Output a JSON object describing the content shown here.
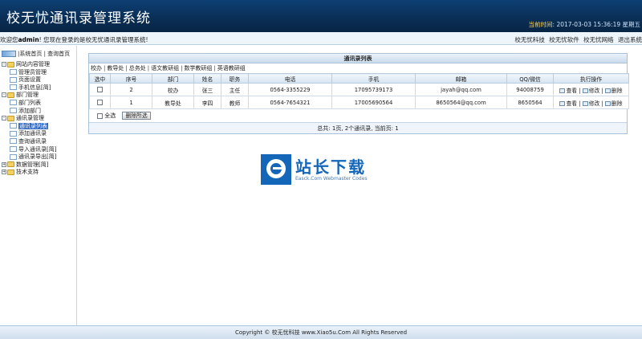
{
  "header": {
    "title": "校无忧通讯录管理系统",
    "time_label": "当前时间:",
    "time_value": "2017-03-03 15:36:19 星期五"
  },
  "topbar": {
    "welcome_prefix": "欢迎您",
    "user": "admin",
    "welcome_suffix": "! 您现在登录的是校无忧通讯录管理系统!",
    "links": [
      "校无忧科技",
      "校无忧软件",
      "校无忧网络",
      "退出系统"
    ]
  },
  "sidebar": {
    "quick_links": "|系统首页 | 查询首页",
    "tree": [
      {
        "label": "网站内容管理",
        "level": 0,
        "type": "folder",
        "pm": "-"
      },
      {
        "label": "管理员管理",
        "level": 1,
        "type": "page"
      },
      {
        "label": "页面设置",
        "level": 1,
        "type": "page"
      },
      {
        "label": "手机信息[简]",
        "level": 1,
        "type": "page"
      },
      {
        "label": "部门管理",
        "level": 0,
        "type": "folder",
        "pm": "-"
      },
      {
        "label": "部门列表",
        "level": 1,
        "type": "page"
      },
      {
        "label": "添加部门",
        "level": 1,
        "type": "page"
      },
      {
        "label": "通讯录管理",
        "level": 0,
        "type": "folder",
        "pm": "-"
      },
      {
        "label": "通讯录列表",
        "level": 1,
        "type": "page",
        "selected": true
      },
      {
        "label": "添加通讯录",
        "level": 1,
        "type": "page"
      },
      {
        "label": "查询通讯录",
        "level": 1,
        "type": "page"
      },
      {
        "label": "导入通讯录[简]",
        "level": 1,
        "type": "page"
      },
      {
        "label": "通讯录导出[简]",
        "level": 1,
        "type": "page"
      },
      {
        "label": "数据管理[简]",
        "level": 0,
        "type": "folder",
        "pm": "+"
      },
      {
        "label": "技术支持",
        "level": 0,
        "type": "folder",
        "pm": "+"
      }
    ]
  },
  "main": {
    "panel_title": "通讯录列表",
    "tabs": [
      "校办",
      "教导处",
      "总务处",
      "语文教研组",
      "数学教研组",
      "英语教研组"
    ],
    "columns": [
      "选中",
      "序号",
      "部门",
      "姓名",
      "职务",
      "电话",
      "手机",
      "邮箱",
      "QQ/微信",
      "执行操作"
    ],
    "rows": [
      {
        "index": "2",
        "dept": "校办",
        "name": "张三",
        "title": "主任",
        "phone": "0564-3355229",
        "mobile": "17095739173",
        "email": "jayah@qq.com",
        "qq": "94008759"
      },
      {
        "index": "1",
        "dept": "教导处",
        "name": "李四",
        "title": "教师",
        "phone": "0564-7654321",
        "mobile": "17005690564",
        "email": "8650564@qq.com",
        "qq": "8650564"
      }
    ],
    "ops": {
      "view": "查看",
      "edit": "修改",
      "delete": "删除"
    },
    "select_all": "全选",
    "delete_selected": "删除所选",
    "pager": "总共: 1页, 2个通讯录, 当前页: 1"
  },
  "watermark": {
    "big": "站长下载",
    "small": "Easck.Com Webmaster Codes"
  },
  "footer": {
    "text": "Copyright © 校无忧科技  www.Xiao5u.Com All Rights Reserved"
  }
}
